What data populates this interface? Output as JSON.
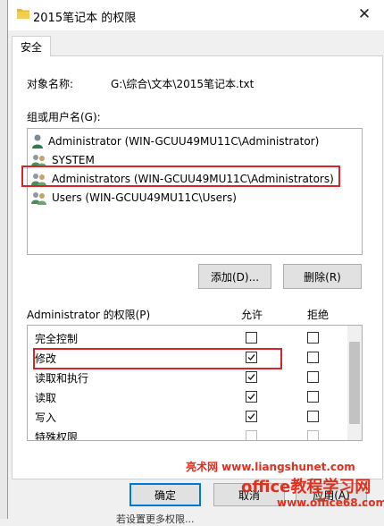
{
  "window": {
    "title": "2015笔记本 的权限",
    "close_glyph": "✕"
  },
  "tabs": [
    {
      "label": "安全"
    }
  ],
  "object": {
    "label": "对象名称:",
    "value": "G:\\综合\\文本\\2015笔记本.txt"
  },
  "groups": {
    "label": "组或用户名(G):",
    "items": [
      {
        "label": "Administrator (WIN-GCUU49MU11C\\Administrator)",
        "icon": "single-user-icon"
      },
      {
        "label": "SYSTEM",
        "icon": "group-users-icon"
      },
      {
        "label": "Administrators (WIN-GCUU49MU11C\\Administrators)",
        "icon": "group-users-icon",
        "highlighted": true
      },
      {
        "label": "Users (WIN-GCUU49MU11C\\Users)",
        "icon": "group-users-icon"
      }
    ]
  },
  "buttons": {
    "add": "添加(D)...",
    "remove": "删除(R)",
    "ok": "确定",
    "cancel": "取消",
    "apply": "应用(A)"
  },
  "permissions": {
    "title": "Administrator 的权限(P)",
    "allow_header": "允许",
    "deny_header": "拒绝",
    "rows": [
      {
        "name": "完全控制",
        "allow": false,
        "deny": false
      },
      {
        "name": "修改",
        "allow": true,
        "deny": false,
        "highlighted": true
      },
      {
        "name": "读取和执行",
        "allow": true,
        "deny": false
      },
      {
        "name": "读取",
        "allow": true,
        "deny": false
      },
      {
        "name": "写入",
        "allow": true,
        "deny": false
      },
      {
        "name": "特殊权限",
        "allow": false,
        "deny": false
      }
    ]
  },
  "watermark": {
    "line1": "亮术网 www.liangshunet.com",
    "line2": "office教程学习网",
    "line3": "www.office68.com"
  },
  "bottom_clip": "若设置更多权限..."
}
